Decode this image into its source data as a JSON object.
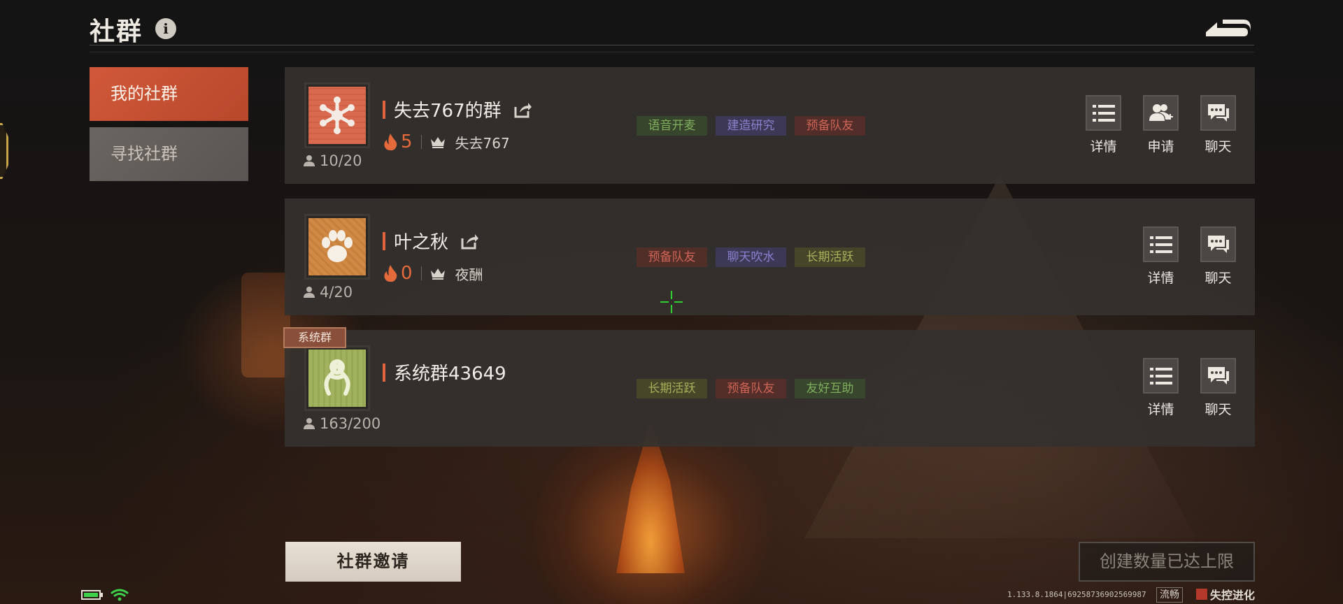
{
  "header": {
    "title": "社群"
  },
  "sidebar": {
    "items": [
      {
        "label": "我的社群",
        "active": true
      },
      {
        "label": "寻找社群",
        "active": false
      }
    ]
  },
  "groups": [
    {
      "name": "失去767的群",
      "members": "10/20",
      "heat": "5",
      "owner": "失去767",
      "badge": "",
      "avatar_icon": "snowflake-icon",
      "tags": [
        {
          "label": "语音开麦",
          "color": "#6e9a4f"
        },
        {
          "label": "建造研究",
          "color": "#6f6ab0"
        },
        {
          "label": "预备队友",
          "color": "#b8554a"
        }
      ],
      "actions": [
        "详情",
        "申请",
        "聊天"
      ]
    },
    {
      "name": "叶之秋",
      "members": "4/20",
      "heat": "0",
      "owner": "夜酬",
      "badge": "",
      "avatar_icon": "paw-icon",
      "tags": [
        {
          "label": "预备队友",
          "color": "#b8554a"
        },
        {
          "label": "聊天吹水",
          "color": "#6f6ab0"
        },
        {
          "label": "长期活跃",
          "color": "#8f9a4a"
        }
      ],
      "actions": [
        "详情",
        "聊天"
      ]
    },
    {
      "name": "系统群43649",
      "members": "163/200",
      "heat": "",
      "owner": "",
      "badge": "系统群",
      "avatar_icon": "rope-knot-icon",
      "tags": [
        {
          "label": "长期活跃",
          "color": "#8f9a4a"
        },
        {
          "label": "预备队友",
          "color": "#b8554a"
        },
        {
          "label": "友好互助",
          "color": "#6e9a4f"
        }
      ],
      "actions": [
        "详情",
        "聊天"
      ]
    }
  ],
  "footer": {
    "invite_label": "社群邀请",
    "create_limit_label": "创建数量已达上限",
    "version": "1.133.8.1864|6925873690256998​7",
    "fluency": "流畅",
    "brand": "失控进化"
  },
  "colors": {
    "accent": "#c9533a",
    "fire": "#e56a3b",
    "crosshair": "#2fd12f"
  }
}
